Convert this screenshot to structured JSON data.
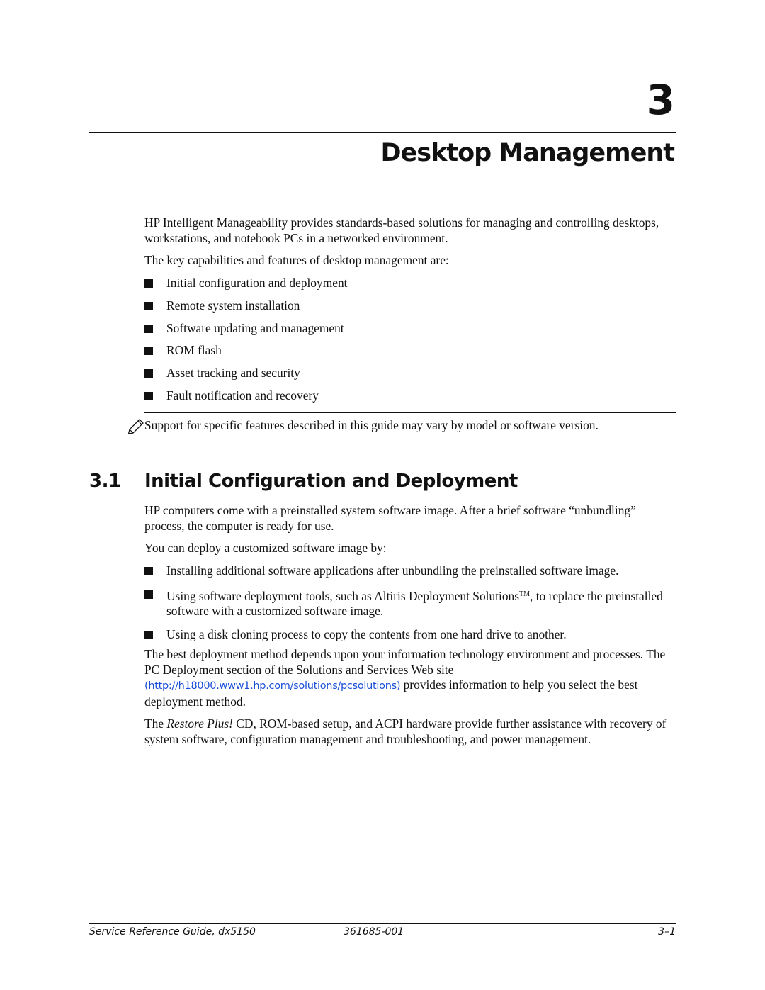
{
  "chapter": {
    "number": "3",
    "title": "Desktop Management"
  },
  "intro": {
    "paragraph1": "HP Intelligent Manageability provides standards-based solutions for managing and controlling desktops, workstations, and notebook PCs in a networked environment.",
    "paragraph2": "The key capabilities and features of desktop management are:",
    "features": [
      "Initial configuration and deployment",
      "Remote system installation",
      "Software updating and management",
      "ROM flash",
      "Asset tracking and security",
      "Fault notification and recovery"
    ]
  },
  "note": {
    "icon": "pencil-note-icon",
    "text": "Support for specific features described in this guide may vary by model or software version."
  },
  "section": {
    "number": "3.1",
    "title": "Initial Configuration and Deployment",
    "paragraph1": "HP computers come with a preinstalled system software image. After a brief software “unbundling” process, the computer is ready for use.",
    "paragraph2": "You can deploy a customized software image by:",
    "methods": {
      "item1": "Installing additional software applications after unbundling the preinstalled software image.",
      "item2_before_tm": "Using software deployment tools, such as Altiris Deployment Solutions",
      "item2_tm": "TM",
      "item2_after_tm": ", to replace the preinstalled software with a customized software image.",
      "item3": "Using a disk cloning process to copy the contents from one hard drive to another."
    },
    "paragraph3_before_link": "The best deployment method depends upon your information technology environment and processes. The PC Deployment section of the Solutions and Services Web site ",
    "paragraph3_link": "(http://h18000.www1.hp.com/solutions/pcsolutions)",
    "paragraph3_after_link": " provides information to help you select the best deployment method.",
    "paragraph4_before_italic": "The ",
    "paragraph4_italic": "Restore Plus!",
    "paragraph4_after_italic": " CD, ROM-based setup, and ACPI hardware provide further assistance with recovery of system software, configuration management and troubleshooting, and power management."
  },
  "footer": {
    "guide_title": "Service Reference Guide, dx5150",
    "part_number": "361685-001",
    "page_number": "3–1"
  },
  "colors": {
    "text": "#111111",
    "link": "#1a4fd8"
  }
}
